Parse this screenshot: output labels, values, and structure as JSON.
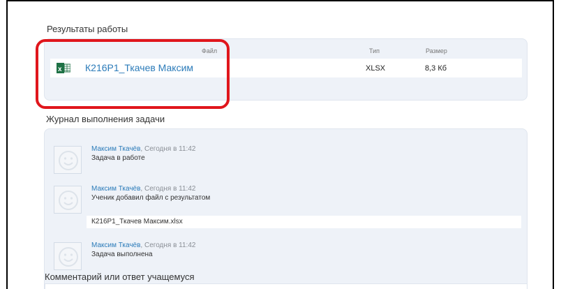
{
  "results": {
    "title": "Результаты работы",
    "columns": {
      "file": "Файл",
      "type": "Тип",
      "size": "Размер"
    },
    "file": {
      "icon": "excel-file-icon",
      "name": "К216Р1_Ткачев Максим",
      "type": "XLSX",
      "size": "8,3 Кб"
    }
  },
  "log": {
    "title": "Журнал выполнения задачи",
    "entries": [
      {
        "author": "Максим Ткачёв",
        "time": ", Сегодня в 11:42",
        "text": "Задача в работе"
      },
      {
        "author": "Максим Ткачёв",
        "time": ", Сегодня в 11:42",
        "text": "Ученик добавил файл с результатом",
        "attachment": "К216Р1_Ткачев Максим.xlsx"
      },
      {
        "author": "Максим Ткачёв",
        "time": ", Сегодня в 11:42",
        "text": "Задача выполнена"
      }
    ]
  },
  "comment": {
    "title": "Комментарий или ответ учащемуся"
  },
  "colors": {
    "highlight": "#e0161c",
    "link": "#2b7bb9",
    "panel": "#eef2f8",
    "excel_green": "#1e7145"
  }
}
